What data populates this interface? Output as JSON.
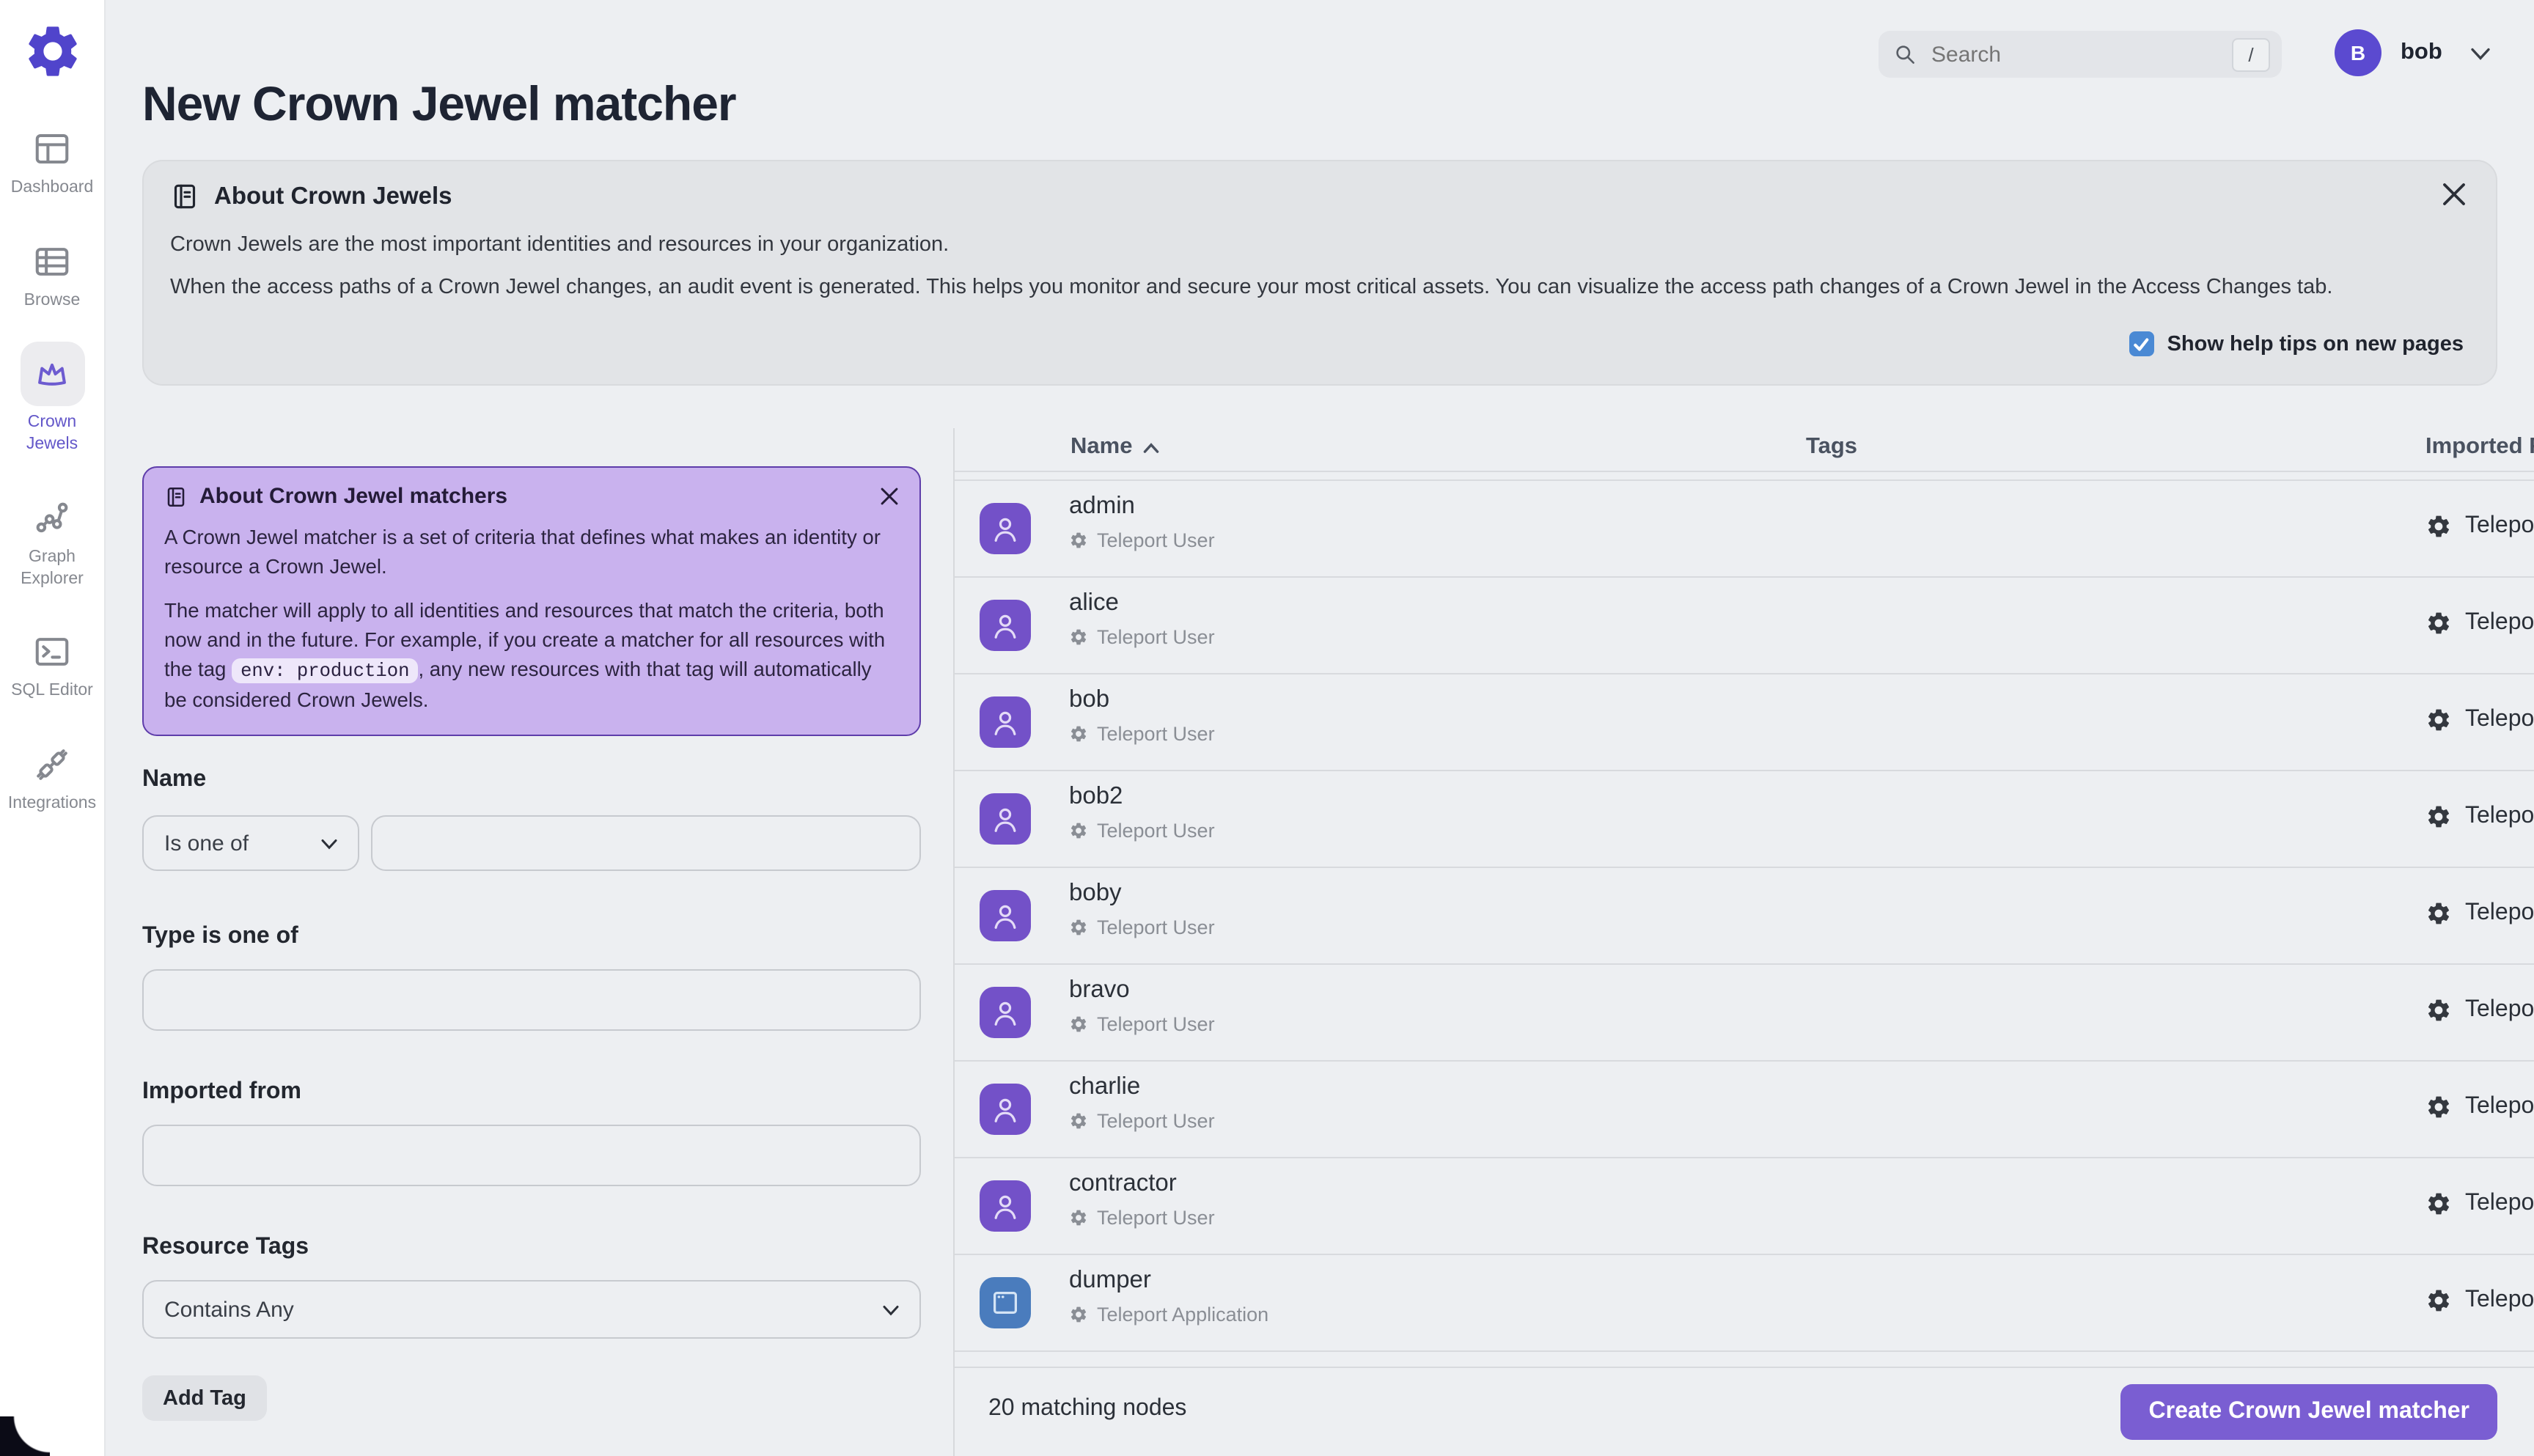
{
  "topbar": {
    "search_placeholder": "Search",
    "search_shortcut": "/",
    "user_initial": "B",
    "user_name": "bob"
  },
  "sidebar": {
    "items": [
      {
        "id": "dashboard",
        "label": "Dashboard",
        "active": false
      },
      {
        "id": "browse",
        "label": "Browse",
        "active": false
      },
      {
        "id": "crown-jewels",
        "label": "Crown Jewels",
        "active": true
      },
      {
        "id": "graph-explorer",
        "label": "Graph Explorer",
        "active": false
      },
      {
        "id": "sql-editor",
        "label": "SQL Editor",
        "active": false
      },
      {
        "id": "integrations",
        "label": "Integrations",
        "active": false
      }
    ]
  },
  "page": {
    "title": "New Crown Jewel matcher"
  },
  "about_banner": {
    "title": "About Crown Jewels",
    "paragraph1": "Crown Jewels are the most important identities and resources in your organization.",
    "paragraph2": "When the access paths of a Crown Jewel changes, an audit event is generated. This helps you monitor and secure your most critical assets. You can visualize the access path changes of a Crown Jewel in the Access Changes tab.",
    "checkbox_label": "Show help tips on new pages",
    "checkbox_checked": true
  },
  "matcher_info": {
    "title": "About Crown Jewel matchers",
    "paragraph1": "A Crown Jewel matcher is a set of criteria that defines what makes an identity or resource a Crown Jewel.",
    "paragraph2_before": "The matcher will apply to all identities and resources that match the criteria, both now and in the future. For example, if you create a matcher for all resources with the tag ",
    "paragraph2_code": "env: production",
    "paragraph2_after": ", any new resources with that tag will automatically be considered Crown Jewels."
  },
  "form": {
    "name_label": "Name",
    "name_operator": "Is one of",
    "name_value": "",
    "type_label": "Type is one of",
    "type_value": "",
    "imported_label": "Imported from",
    "imported_value": "",
    "tags_label": "Resource Tags",
    "tags_operator": "Contains Any",
    "add_tag_label": "Add Tag"
  },
  "table": {
    "columns": [
      "Name",
      "Tags",
      "Imported From"
    ],
    "sort": {
      "column": "Name",
      "direction": "asc"
    },
    "rows": [
      {
        "name": "admin",
        "subtype": "Teleport User",
        "icon": "user",
        "imported": "Teleport"
      },
      {
        "name": "alice",
        "subtype": "Teleport User",
        "icon": "user",
        "imported": "Teleport"
      },
      {
        "name": "bob",
        "subtype": "Teleport User",
        "icon": "user",
        "imported": "Teleport"
      },
      {
        "name": "bob2",
        "subtype": "Teleport User",
        "icon": "user",
        "imported": "Teleport"
      },
      {
        "name": "boby",
        "subtype": "Teleport User",
        "icon": "user",
        "imported": "Teleport"
      },
      {
        "name": "bravo",
        "subtype": "Teleport User",
        "icon": "user",
        "imported": "Teleport"
      },
      {
        "name": "charlie",
        "subtype": "Teleport User",
        "icon": "user",
        "imported": "Teleport"
      },
      {
        "name": "contractor",
        "subtype": "Teleport User",
        "icon": "user",
        "imported": "Teleport"
      },
      {
        "name": "dumper",
        "subtype": "Teleport Application",
        "icon": "app",
        "imported": "Teleport"
      }
    ]
  },
  "footer": {
    "count_text": "20 matching nodes",
    "create_label": "Create Crown Jewel matcher"
  },
  "colors": {
    "brand": "#5044cb",
    "accent_button": "#7a5ed2",
    "info_box_bg": "#c9b2ee",
    "checkbox_blue": "#4a89d4",
    "avatar_user": "#7351c8",
    "avatar_app": "#4a7cbd",
    "page_bg": "#edeff2"
  }
}
